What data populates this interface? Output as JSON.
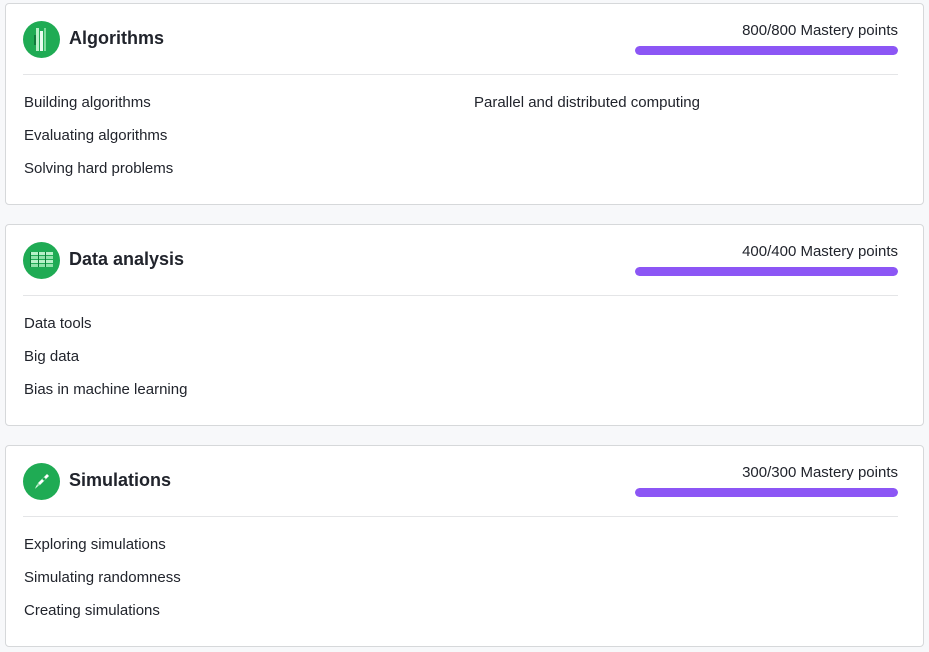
{
  "courses": [
    {
      "title": "Algorithms",
      "icon": "algorithms-icon",
      "mastery_text": "800/800 Mastery points",
      "mastery_fraction": 1.0,
      "units_left": [
        "Building algorithms",
        "Evaluating algorithms",
        "Solving hard problems"
      ],
      "units_right": [
        "Parallel and distributed computing"
      ]
    },
    {
      "title": "Data analysis",
      "icon": "data-table-icon",
      "mastery_text": "400/400 Mastery points",
      "mastery_fraction": 1.0,
      "units_left": [
        "Data tools",
        "Big data",
        "Bias in machine learning"
      ],
      "units_right": []
    },
    {
      "title": "Simulations",
      "icon": "rocket-icon",
      "mastery_text": "300/300 Mastery points",
      "mastery_fraction": 1.0,
      "units_left": [
        "Exploring simulations",
        "Simulating randomness",
        "Creating simulations"
      ],
      "units_right": []
    }
  ],
  "colors": {
    "mastery_bar": "#8c56f5",
    "icon_background": "#1fab54",
    "card_border": "#d6d8da",
    "page_background": "#f7f8fa"
  }
}
